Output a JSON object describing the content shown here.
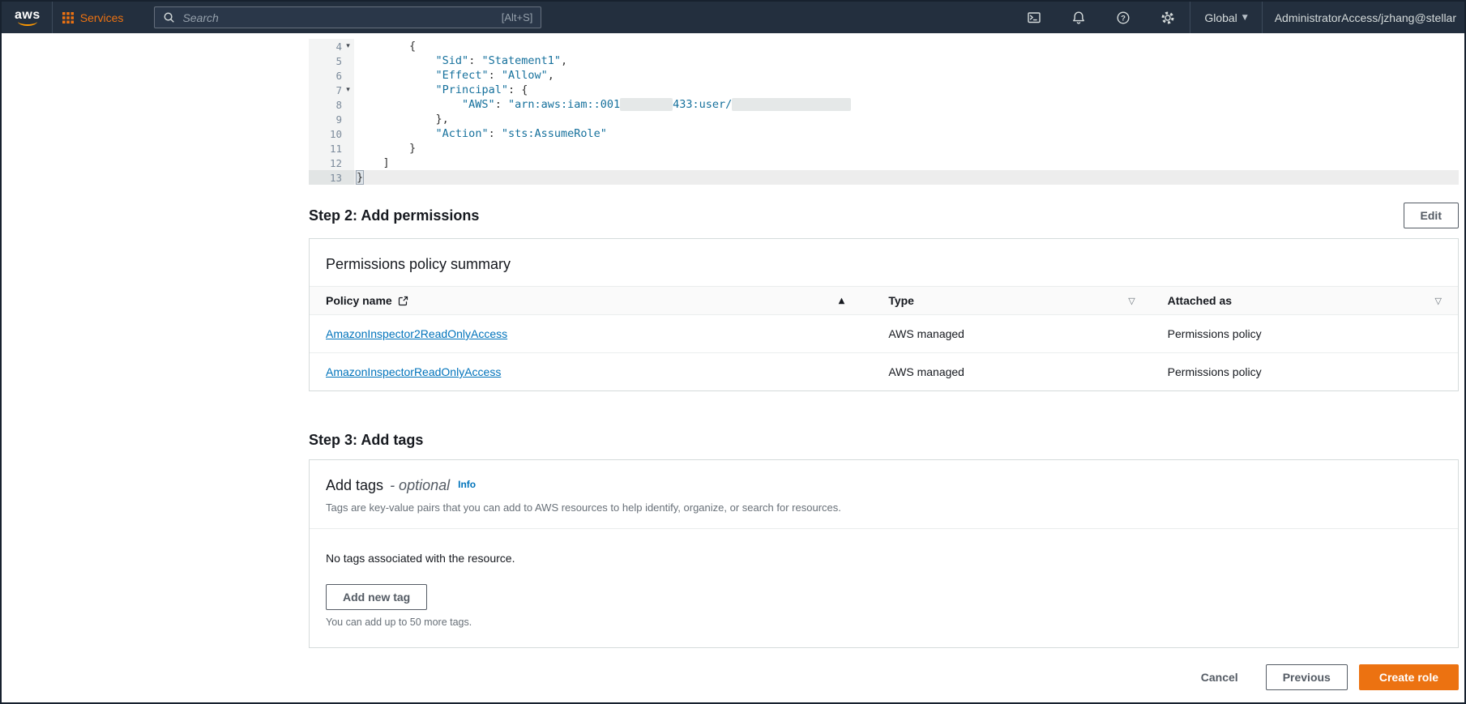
{
  "topnav": {
    "logo_text": "aws",
    "services_label": "Services",
    "search_placeholder": "Search",
    "search_shortcut": "[Alt+S]",
    "region_label": "Global",
    "account_label": "AdministratorAccess/jzhang@stellar"
  },
  "icons": {
    "fold_caret": "▾",
    "sort_ascending": "▲",
    "filter_caret": "▽",
    "chevron_down": "▼"
  },
  "code_editor": {
    "lines": [
      {
        "num": "4",
        "fold": true,
        "segments": [
          {
            "c": "p",
            "v": "        {"
          }
        ]
      },
      {
        "num": "5",
        "fold": false,
        "segments": [
          {
            "c": "p",
            "v": "            "
          },
          {
            "c": "k",
            "v": "\"Sid\""
          },
          {
            "c": "p",
            "v": ": "
          },
          {
            "c": "s",
            "v": "\"Statement1\""
          },
          {
            "c": "p",
            "v": ","
          }
        ]
      },
      {
        "num": "6",
        "fold": false,
        "segments": [
          {
            "c": "p",
            "v": "            "
          },
          {
            "c": "k",
            "v": "\"Effect\""
          },
          {
            "c": "p",
            "v": ": "
          },
          {
            "c": "s",
            "v": "\"Allow\""
          },
          {
            "c": "p",
            "v": ","
          }
        ]
      },
      {
        "num": "7",
        "fold": true,
        "segments": [
          {
            "c": "p",
            "v": "            "
          },
          {
            "c": "k",
            "v": "\"Principal\""
          },
          {
            "c": "p",
            "v": ": {"
          }
        ]
      },
      {
        "num": "8",
        "fold": false,
        "segments": [
          {
            "c": "p",
            "v": "                "
          },
          {
            "c": "k",
            "v": "\"AWS\""
          },
          {
            "c": "p",
            "v": ": "
          },
          {
            "c": "s",
            "v": "\"arn:aws:iam::001"
          },
          {
            "c": "r",
            "v": "        "
          },
          {
            "c": "s",
            "v": "433:user/"
          },
          {
            "c": "r",
            "v": "                  "
          }
        ]
      },
      {
        "num": "9",
        "fold": false,
        "segments": [
          {
            "c": "p",
            "v": "            },"
          }
        ]
      },
      {
        "num": "10",
        "fold": false,
        "segments": [
          {
            "c": "p",
            "v": "            "
          },
          {
            "c": "k",
            "v": "\"Action\""
          },
          {
            "c": "p",
            "v": ": "
          },
          {
            "c": "s",
            "v": "\"sts:AssumeRole\""
          }
        ]
      },
      {
        "num": "11",
        "fold": false,
        "segments": [
          {
            "c": "p",
            "v": "        }"
          }
        ]
      },
      {
        "num": "12",
        "fold": false,
        "segments": [
          {
            "c": "p",
            "v": "    ]"
          }
        ]
      },
      {
        "num": "13",
        "fold": false,
        "active": true,
        "segments": [
          {
            "c": "b",
            "v": "}"
          }
        ]
      }
    ]
  },
  "step2": {
    "heading": "Step 2: Add permissions",
    "edit_button": "Edit",
    "card_title": "Permissions policy summary",
    "table": {
      "columns": [
        "Policy name",
        "Type",
        "Attached as"
      ],
      "rows": [
        {
          "policy": "AmazonInspector2ReadOnlyAccess",
          "type": "AWS managed",
          "attached_as": "Permissions policy"
        },
        {
          "policy": "AmazonInspectorReadOnlyAccess",
          "type": "AWS managed",
          "attached_as": "Permissions policy"
        }
      ]
    }
  },
  "step3": {
    "heading": "Step 3: Add tags",
    "card_title": "Add tags",
    "card_title_suffix": "- optional",
    "info_link": "Info",
    "description": "Tags are key-value pairs that you can add to AWS resources to help identify, organize, or search for resources.",
    "empty_text": "No tags associated with the resource.",
    "add_button": "Add new tag",
    "hint": "You can add up to 50 more tags."
  },
  "footer": {
    "cancel": "Cancel",
    "previous": "Previous",
    "create": "Create role"
  },
  "colors": {
    "nav_bg": "#232f3e",
    "accent_orange": "#ec7211",
    "link_blue": "#0073bb",
    "code_string_blue": "#15709c"
  }
}
